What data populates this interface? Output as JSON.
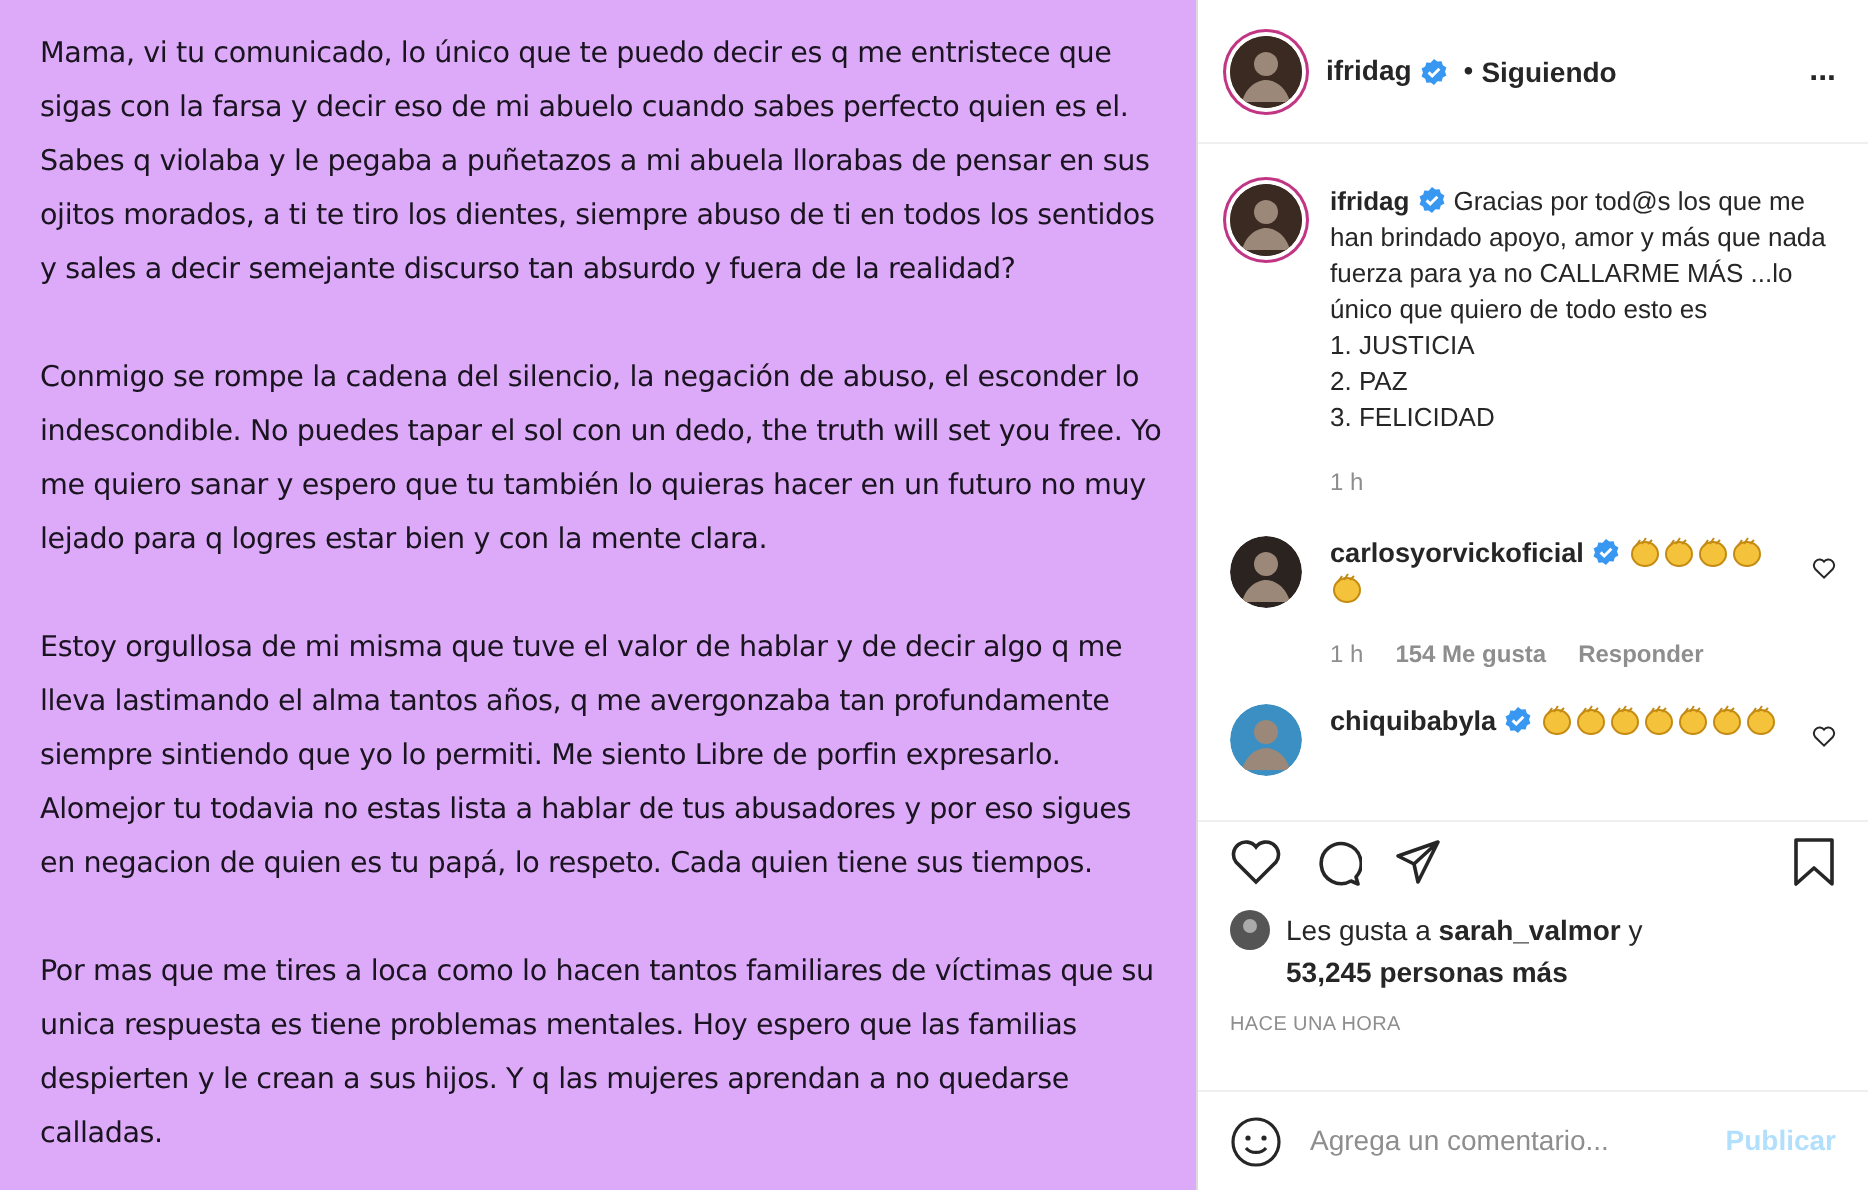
{
  "post_image": {
    "paragraphs": [
      "Mama, vi tu comunicado, lo único que te puedo decir es q me entristece que sigas con la farsa y decir eso de mi abuelo cuando sabes perfecto quien es el. Sabes q violaba y le pegaba a puñetazos a mi abuela llorabas de pensar en sus ojitos morados, a ti te tiro los dientes, siempre abuso de ti en todos los sentidos y sales a decir semejante discurso tan absurdo y fuera de la realidad?",
      "Conmigo se rompe la cadena del silencio, la negación de abuso, el esconder lo indescondible. No puedes tapar el sol con un dedo, the truth will set you free. Yo me quiero sanar y espero que tu también lo quieras hacer en un futuro no muy lejado para q logres estar bien y con la mente clara.",
      "Estoy orgullosa de mi misma que tuve el valor de hablar y de decir algo q me lleva lastimando el alma tantos años, q me avergonzaba tan profundamente siempre sintiendo que yo lo permiti. Me siento Libre de porfin expresarlo. Alomejor tu todavia no estas lista a hablar de tus abusadores y por eso sigues en negacion de quien es tu papá, lo respeto. Cada quien tiene sus tiempos.",
      "Por mas que me tires a loca como lo hacen tantos familiares de víctimas que su unica respuesta es tiene problemas mentales. Hoy espero que las familias despierten y le crean a sus hijos. Y q las mujeres aprendan a no quedarse calladas."
    ]
  },
  "header": {
    "username": "ifridag",
    "verified": true,
    "separator": "•",
    "follow_status": "Siguiendo",
    "more": "..."
  },
  "caption": {
    "username": "ifridag",
    "verified": true,
    "lines": [
      "Gracias por tod@s los que me han brindado apoyo, amor y más que nada fuerza para ya no CALLARME MÁS ...lo único que quiero de todo esto es",
      "1. JUSTICIA",
      "2. PAZ",
      "3. FELICIDAD"
    ],
    "time": "1 h"
  },
  "comments": [
    {
      "username": "carlosyorvickoficial",
      "verified": true,
      "emojis": [
        {
          "kind": "clap"
        },
        {
          "kind": "clap"
        },
        {
          "kind": "clap"
        },
        {
          "kind": "clap"
        },
        {
          "kind": "clap"
        }
      ],
      "time": "1 h",
      "likes": "154 Me gusta",
      "reply": "Responder",
      "liked": false
    },
    {
      "username": "chiquibabyla",
      "verified": true,
      "emojis": [
        {
          "kind": "clap"
        },
        {
          "kind": "clap"
        },
        {
          "kind": "clap"
        },
        {
          "kind": "clap"
        },
        {
          "kind": "clap"
        },
        {
          "kind": "clap"
        },
        {
          "kind": "clap"
        }
      ],
      "liked": false
    }
  ],
  "actions": {
    "liked": false,
    "saved": false
  },
  "likes": {
    "prefix": "Les gusta a",
    "user": "sarah_valmor",
    "suffix": "y",
    "others": "53,245 personas más"
  },
  "timestamp": "HACE UNA HORA",
  "comment_box": {
    "placeholder": "Agrega un comentario...",
    "submit": "Publicar"
  }
}
